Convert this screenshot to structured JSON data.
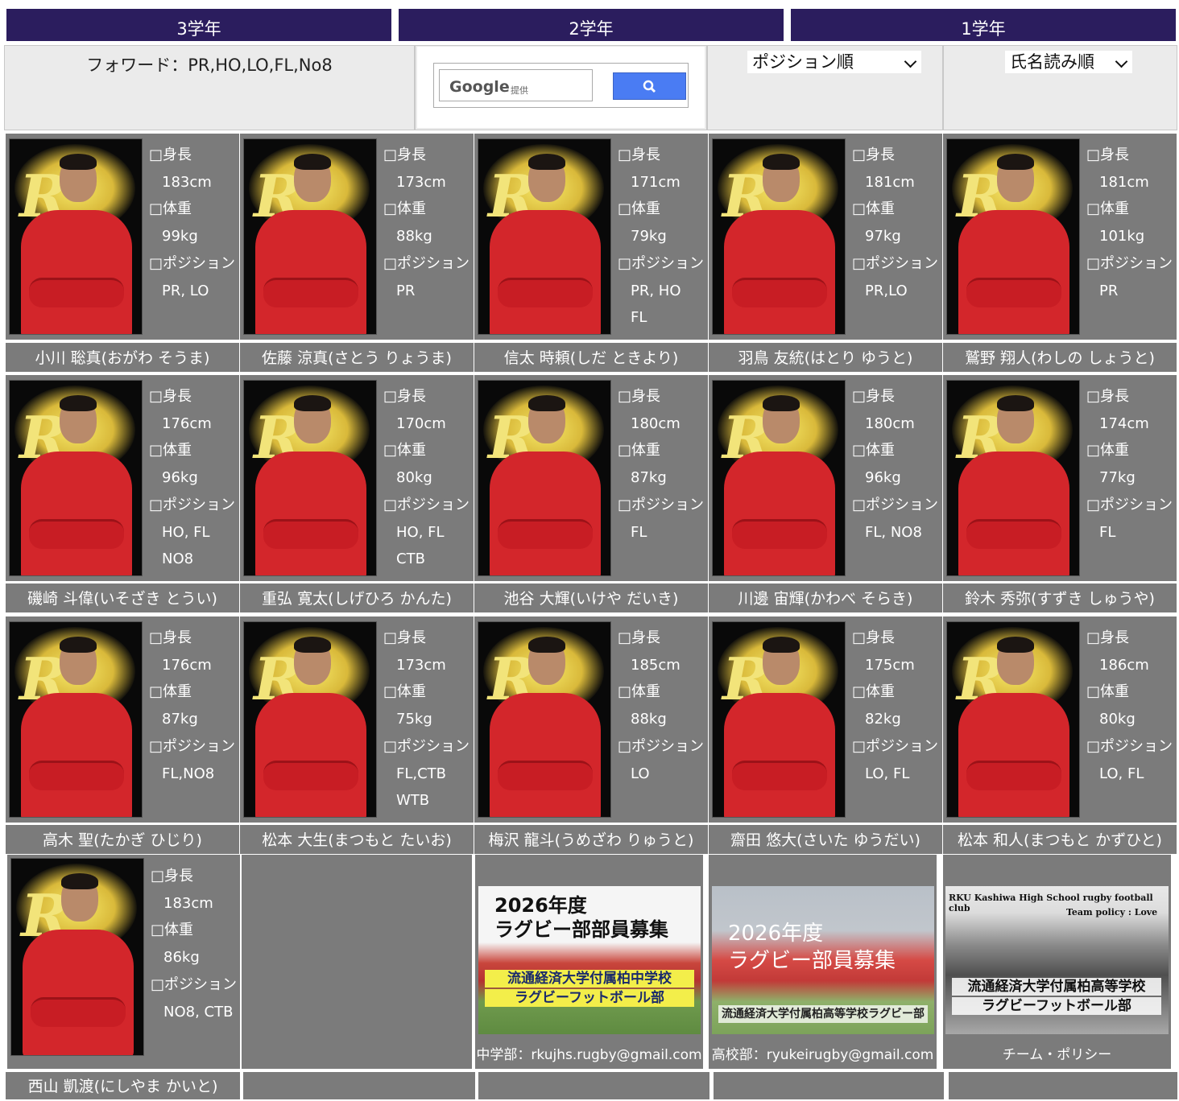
{
  "grade_tabs": [
    "3学年",
    "2学年",
    "1学年"
  ],
  "position_text": "フォワード：PR,HO,LO,FL,No8",
  "search": {
    "brand": "Google",
    "provided": "提供"
  },
  "selects": {
    "sort_position": "ポジション順",
    "sort_name": "氏名読み順"
  },
  "labels": {
    "height": "□身長",
    "weight": "□体重",
    "position": "□ポジション"
  },
  "players": [
    {
      "name": "小川 聡真(おがわ そうま)",
      "height": "183cm",
      "weight": "99kg",
      "pos": "PR, LO",
      "pos2": ""
    },
    {
      "name": "佐藤 涼真(さとう りょうま)",
      "height": "173cm",
      "weight": "88kg",
      "pos": "PR",
      "pos2": ""
    },
    {
      "name": "信太 時頼(しだ ときより)",
      "height": "171cm",
      "weight": "79kg",
      "pos": "PR, HO",
      "pos2": "FL"
    },
    {
      "name": "羽鳥 友統(はとり ゆうと)",
      "height": "181cm",
      "weight": "97kg",
      "pos": "PR,LO",
      "pos2": ""
    },
    {
      "name": "鷲野 翔人(わしの しょうと)",
      "height": "181cm",
      "weight": "101kg",
      "pos": "PR",
      "pos2": ""
    },
    {
      "name": "磯崎 斗偉(いそざき とうい)",
      "height": "176cm",
      "weight": "96kg",
      "pos": "HO, FL",
      "pos2": "NO8"
    },
    {
      "name": "重弘 寛太(しげひろ かんた)",
      "height": "170cm",
      "weight": "80kg",
      "pos": "HO, FL",
      "pos2": "CTB"
    },
    {
      "name": "池谷 大輝(いけや だいき)",
      "height": "180cm",
      "weight": "87kg",
      "pos": "FL",
      "pos2": ""
    },
    {
      "name": "川邊 宙輝(かわべ そらき)",
      "height": "180cm",
      "weight": "96kg",
      "pos": "FL, NO8",
      "pos2": ""
    },
    {
      "name": "鈴木 秀弥(すずき しゅうや)",
      "height": "174cm",
      "weight": "77kg",
      "pos": "FL",
      "pos2": ""
    },
    {
      "name": "高木 聖(たかぎ ひじり)",
      "height": "176cm",
      "weight": "87kg",
      "pos": "FL,NO8",
      "pos2": ""
    },
    {
      "name": "松本 大生(まつもと たいお)",
      "height": "173cm",
      "weight": "75kg",
      "pos": "FL,CTB",
      "pos2": "WTB"
    },
    {
      "name": "梅沢 龍斗(うめざわ りゅうと)",
      "height": "185cm",
      "weight": "88kg",
      "pos": "LO",
      "pos2": ""
    },
    {
      "name": "齋田 悠大(さいた ゆうだい)",
      "height": "175cm",
      "weight": "82kg",
      "pos": "LO, FL",
      "pos2": ""
    },
    {
      "name": "松本 和人(まつもと かずひと)",
      "height": "186cm",
      "weight": "80kg",
      "pos": "LO, FL",
      "pos2": ""
    },
    {
      "name": "西山 凱渡(にしやま かいと)",
      "height": "183cm",
      "weight": "86kg",
      "pos": "NO8, CTB",
      "pos2": ""
    }
  ],
  "banners": [
    {
      "title1": "2026年度",
      "title2": "ラグビー部部員募集",
      "sub1": "流通経済大学付属柏中学校",
      "sub2": "ラグビーフットボール部",
      "caption": "中学部：rkujhs.rugby@gmail.com"
    },
    {
      "title1": "2026年度",
      "title2": "ラグビー部員募集",
      "sub1": "流通経済大学付属柏高等学校ラグビー部",
      "sub2": "",
      "caption": "高校部：ryukeirugby@gmail.com"
    },
    {
      "title1": "RKU Kashiwa High School rugby football club",
      "title2": "Team policy : Love",
      "sub1": "流通経済大学付属柏高等学校",
      "sub2": "ラグビーフットボール部",
      "caption": "チーム・ポリシー"
    }
  ]
}
